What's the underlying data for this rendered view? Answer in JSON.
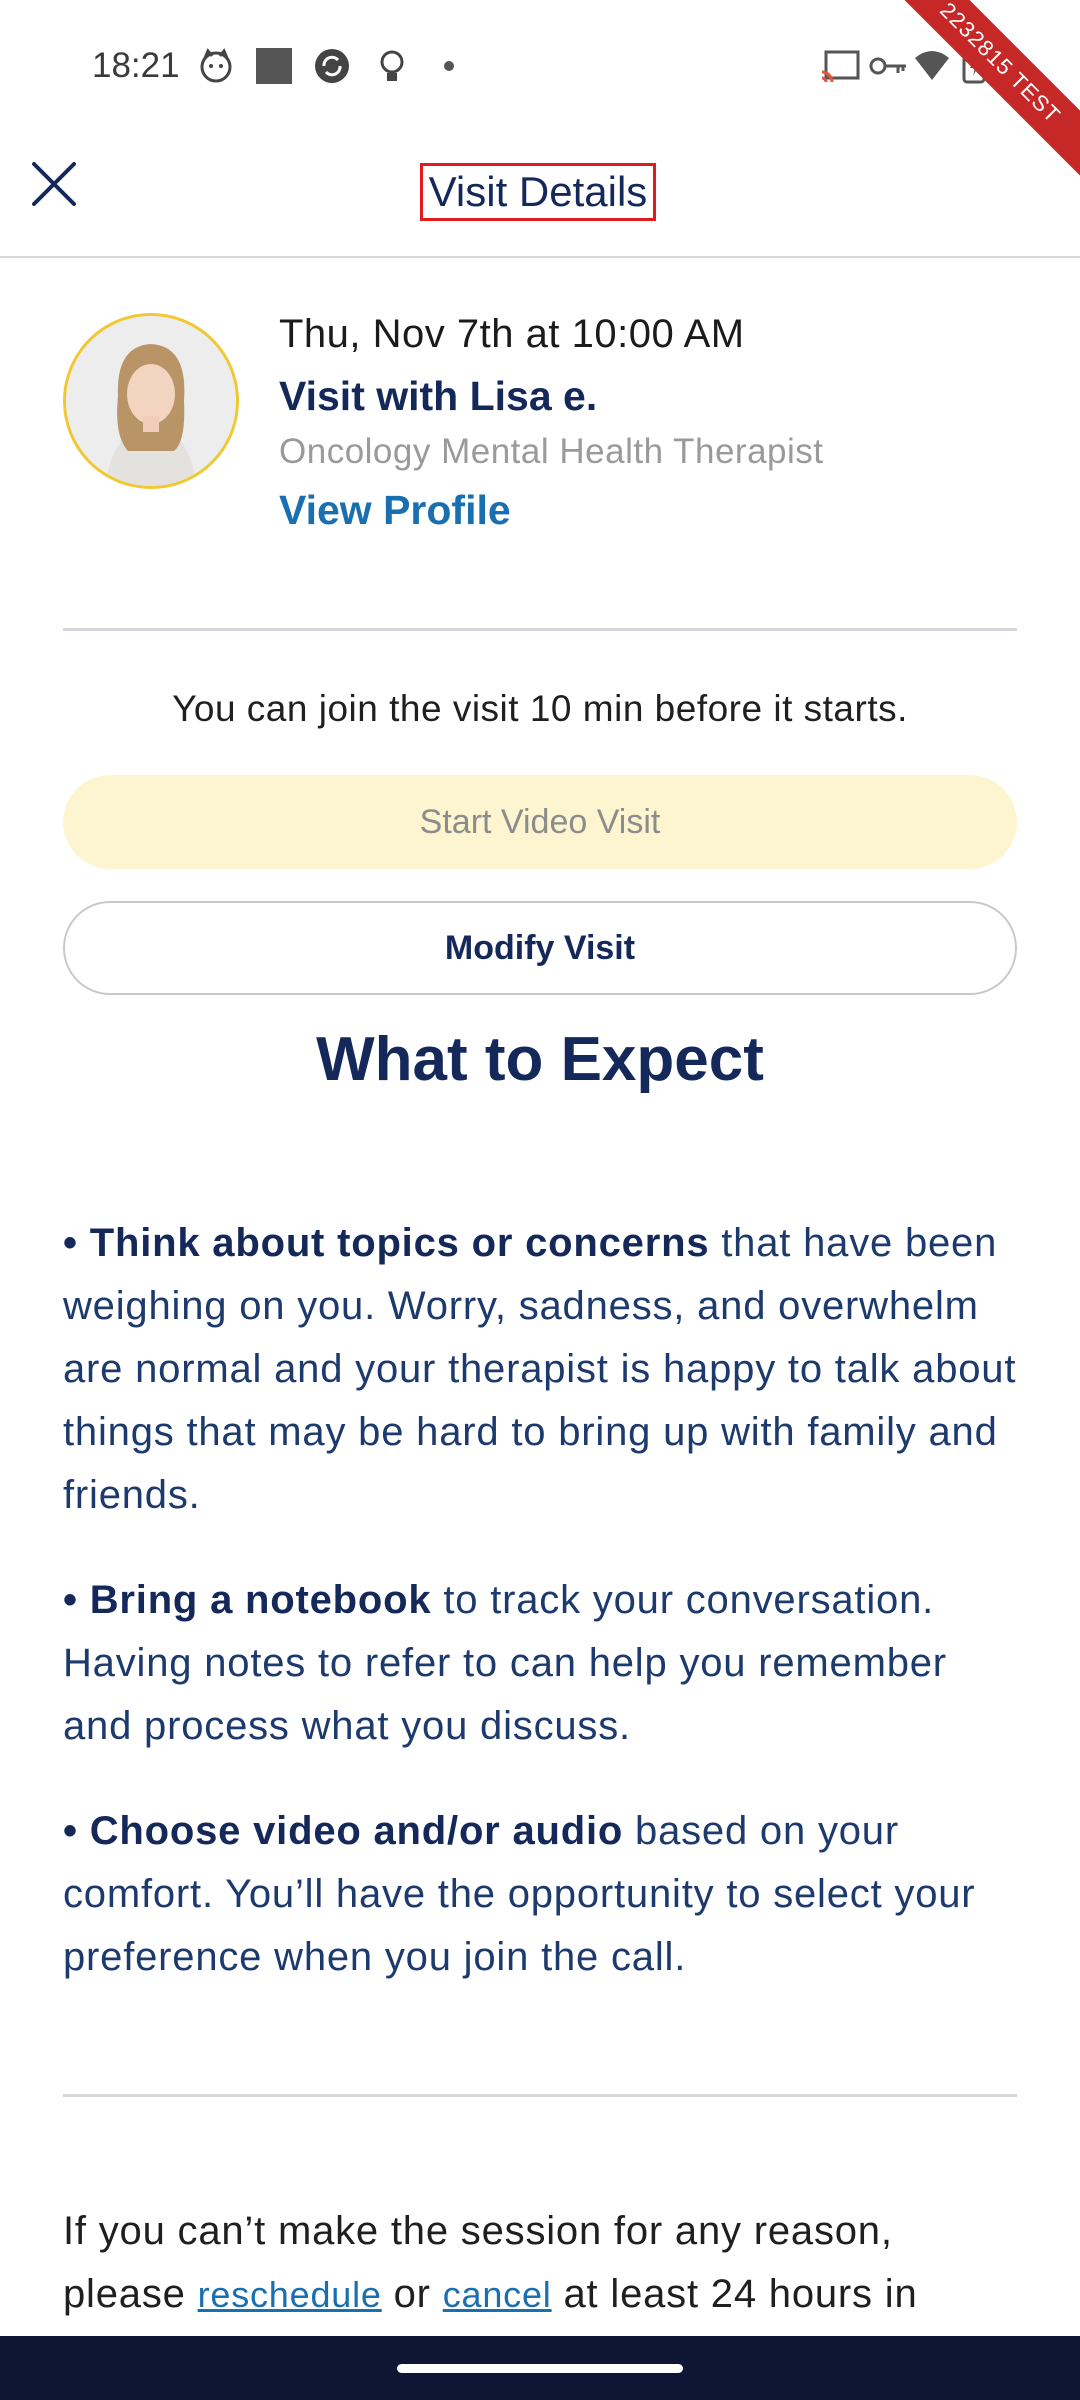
{
  "status_bar": {
    "time": "18:21",
    "ribbon_text": "2232815 TEST",
    "left_icons": [
      "cat-face-icon",
      "square-icon",
      "sync-icon",
      "bulb-icon",
      "dot-icon"
    ],
    "right_icons": [
      "cast-icon",
      "key-icon",
      "wifi-icon",
      "battery-charging-icon"
    ]
  },
  "app_bar": {
    "title": "Visit Details",
    "close_icon": "close-icon"
  },
  "visit": {
    "date": "Thu, Nov 7th at 10:00 AM",
    "with": "Visit with Lisa e.",
    "role": "Oncology Mental Health Therapist",
    "view_profile": "View Profile"
  },
  "actions": {
    "join_note": "You can join the visit 10 min before it starts.",
    "start_video": "Start Video Visit",
    "modify": "Modify Visit"
  },
  "expect": {
    "title": "What to Expect",
    "tips": [
      {
        "bullet": "•",
        "bold": "Think about topics or concerns",
        "text": " that have been weighing on you. Worry, sadness, and overwhelm are normal and your therapist is happy to talk about things that may be hard to bring up with family and friends."
      },
      {
        "bullet": "•",
        "bold": "Bring a notebook",
        "text": " to track your conversation. Having notes to refer to can help you remember and process what you discuss."
      },
      {
        "bullet": "•",
        "bold": "Choose video and/or audio",
        "text": " based on your comfort. You’ll have the opportunity to select your preference when you join the call."
      }
    ]
  },
  "footer": {
    "prefix": "If you can’t make the session for any reason, please ",
    "reschedule": "reschedule",
    "or": " or ",
    "cancel": "cancel",
    "suffix": " at least 24 hours in"
  },
  "colors": {
    "navy": "#14285a",
    "link": "#1a6fb0",
    "start_button_bg": "#fdf5d0",
    "avatar_ring": "#f1c832"
  }
}
